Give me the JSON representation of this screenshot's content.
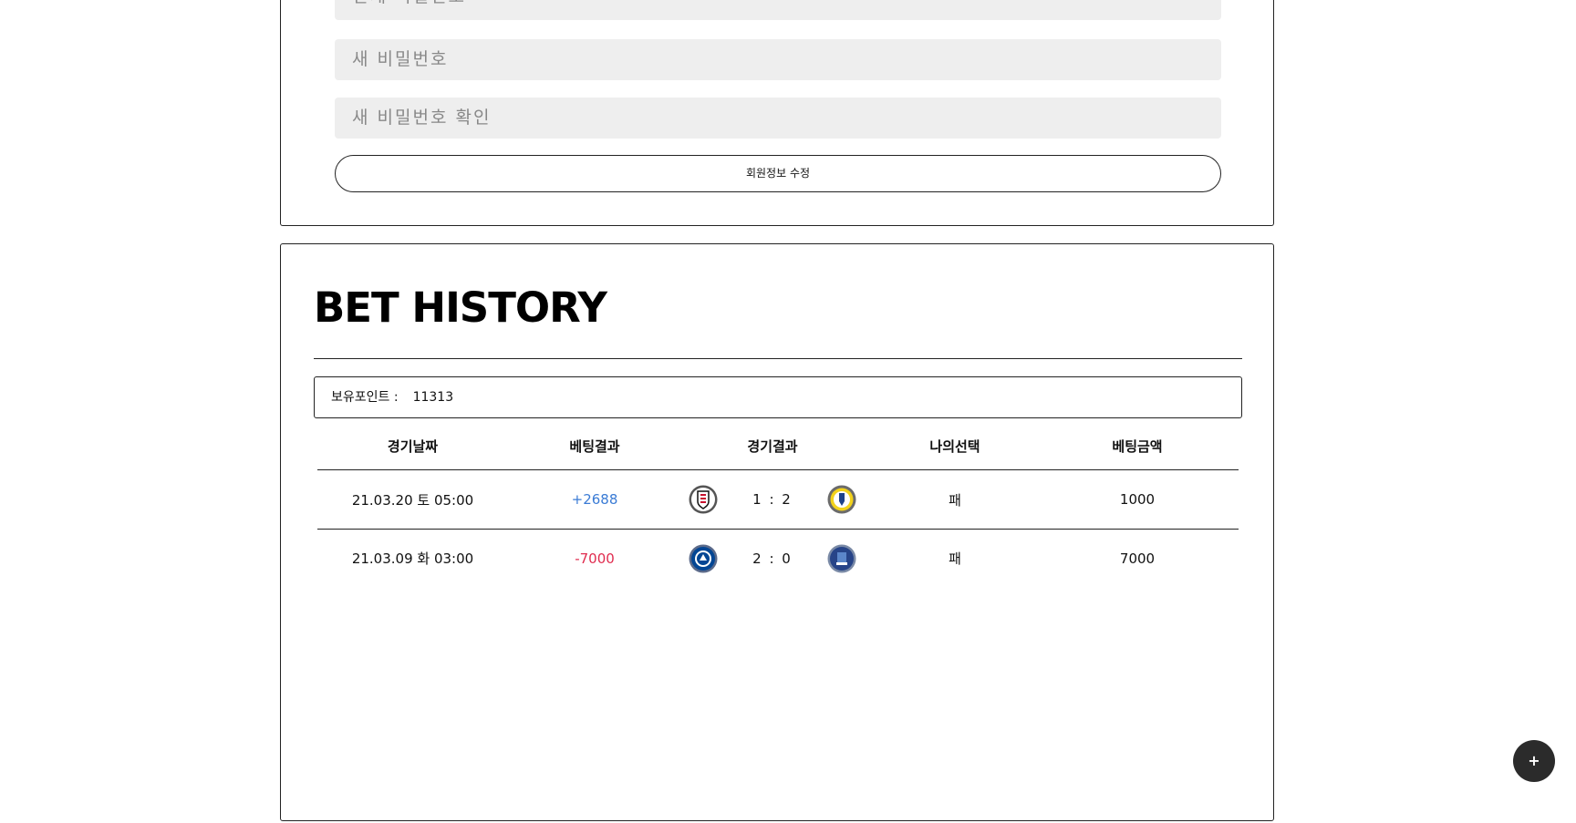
{
  "profile_form": {
    "current_password_placeholder": "현재 비밀번호",
    "new_password_placeholder": "새 비밀번호",
    "confirm_password_placeholder": "새 비밀번호 확인",
    "submit_label": "회원정보 수정"
  },
  "bet_history": {
    "title": "BET HISTORY",
    "points_label": "보유포인트 :",
    "points_value": "11313",
    "columns": [
      "경기날짜",
      "베팅결과",
      "경기결과",
      "나의선택",
      "베팅금액"
    ],
    "rows": [
      {
        "date": "21.03.20 토 05:00",
        "result": "+2688",
        "score": "1 : 2",
        "home_logo": "fulham-crest-icon",
        "away_logo": "leeds-crest-icon",
        "choice": "패",
        "amount": "1000"
      },
      {
        "date": "21.03.09 화 03:00",
        "result": "-7000",
        "score": "2 : 0",
        "home_logo": "chelsea-crest-icon",
        "away_logo": "everton-crest-icon",
        "choice": "패",
        "amount": "7000"
      }
    ]
  },
  "fab": {
    "label": "+"
  },
  "colors": {
    "win": "#3a7bd5",
    "loss": "#e02c4f",
    "input_bg": "#eeeeee",
    "fab_bg": "#2b2b2b"
  }
}
